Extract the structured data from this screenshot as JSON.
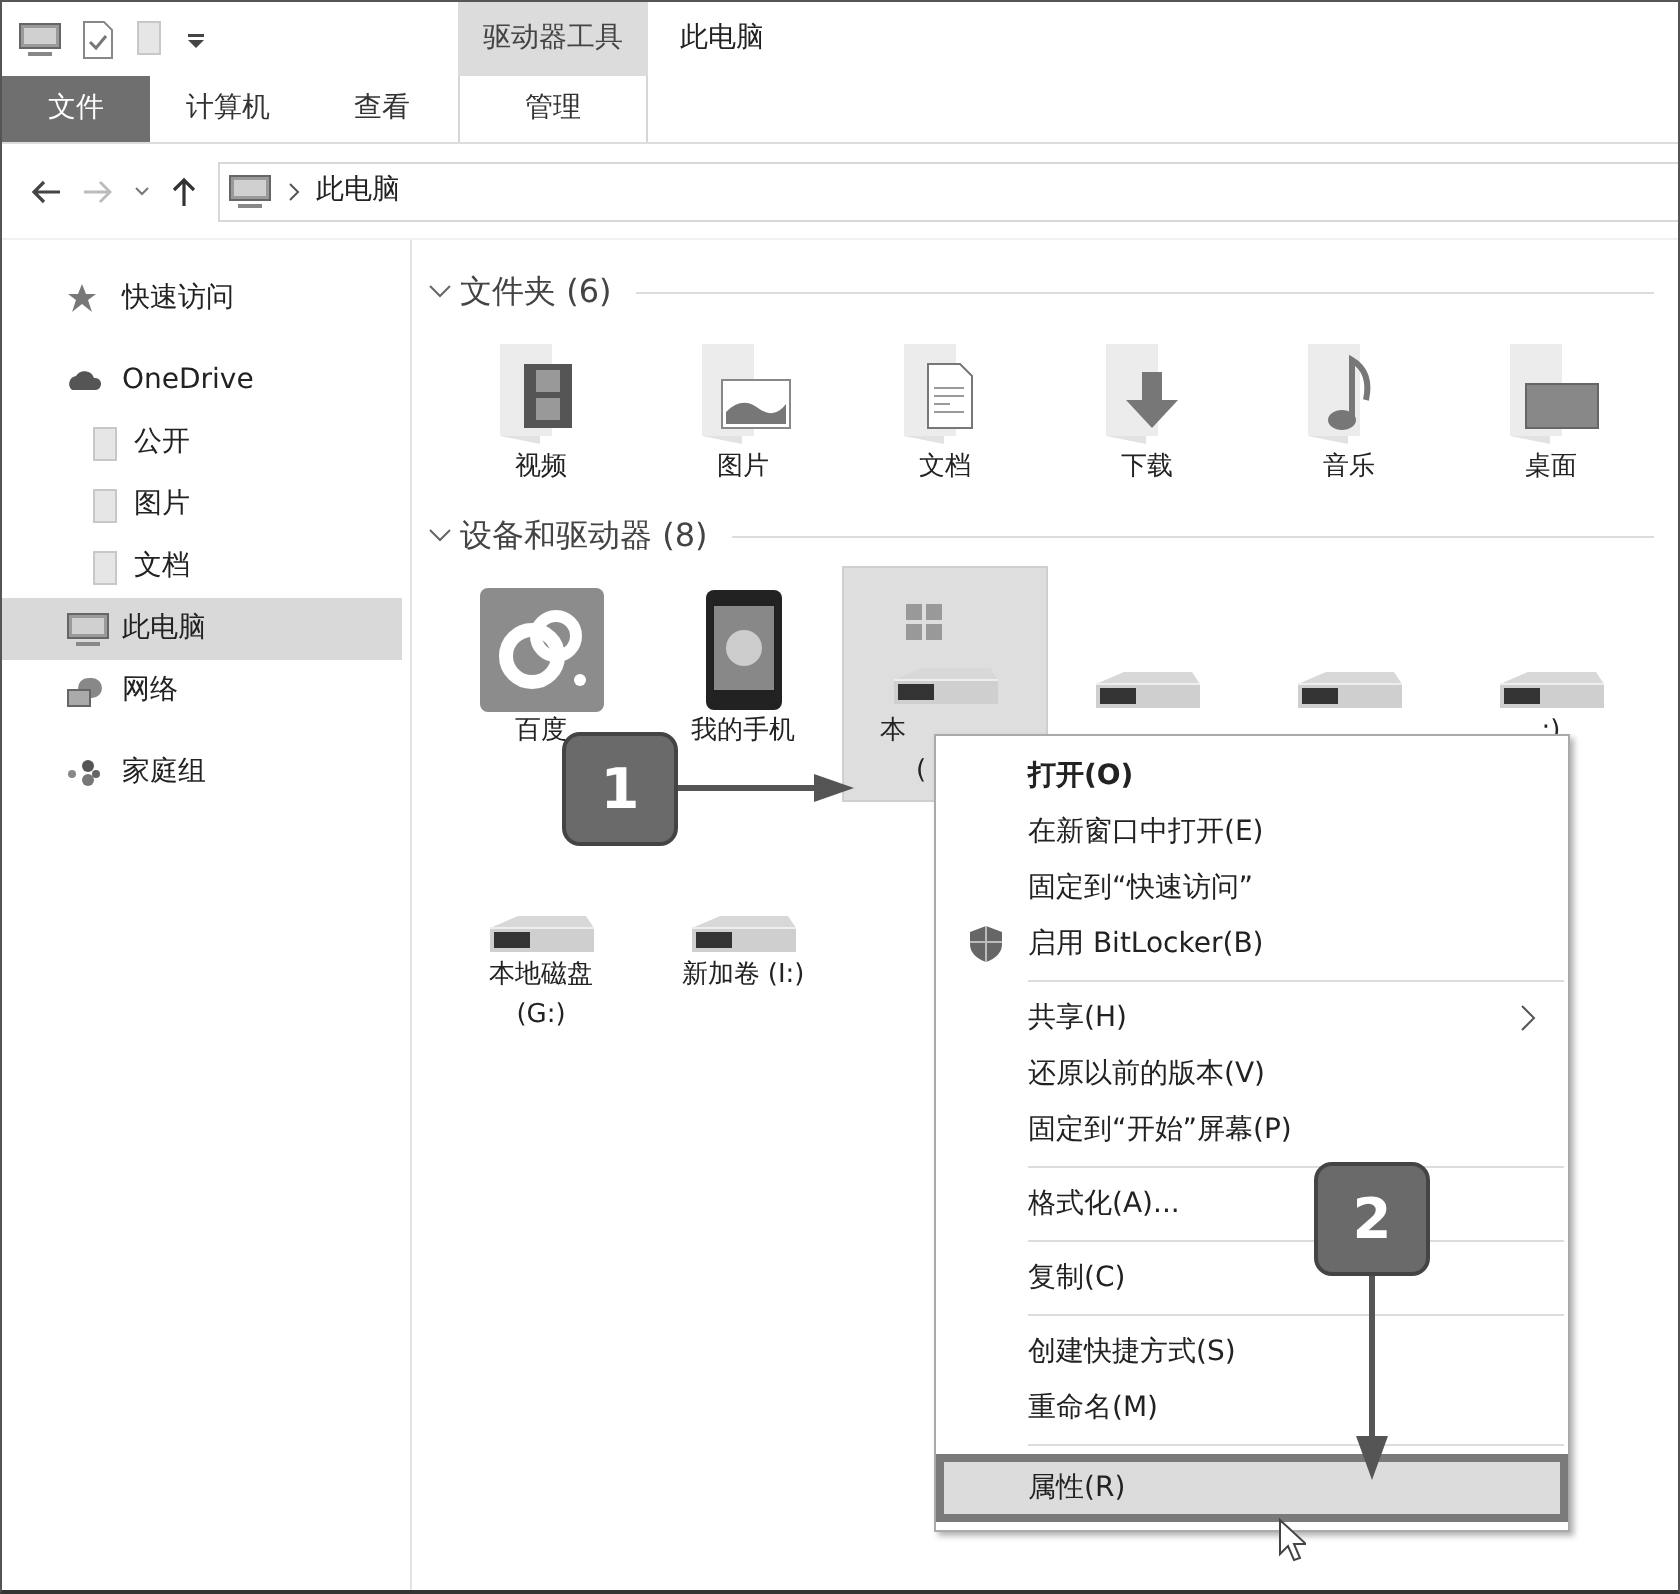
{
  "window": {
    "title": "此电脑",
    "context_tab_group": "驱动器工具"
  },
  "ribbon_tabs": [
    {
      "label": "文件",
      "kind": "file"
    },
    {
      "label": "计算机",
      "kind": "tab"
    },
    {
      "label": "查看",
      "kind": "tab"
    },
    {
      "label": "管理",
      "kind": "context"
    }
  ],
  "address_bar": {
    "path": [
      "此电脑"
    ]
  },
  "sidebar": {
    "items": [
      {
        "label": "快速访问",
        "kind": "star",
        "selected": false
      },
      {
        "label": "OneDrive",
        "kind": "cloud",
        "selected": false,
        "children": [
          {
            "label": "公开",
            "kind": "folder",
            "selected": false
          },
          {
            "label": "图片",
            "kind": "folder",
            "selected": false
          },
          {
            "label": "文档",
            "kind": "folder",
            "selected": false
          }
        ]
      },
      {
        "label": "此电脑",
        "kind": "pc",
        "selected": true
      },
      {
        "label": "网络",
        "kind": "network",
        "selected": false
      },
      {
        "label": "家庭组",
        "kind": "homegroup",
        "selected": false
      }
    ]
  },
  "groups": [
    {
      "header": "文件夹 (6)",
      "items": [
        {
          "label": "视频",
          "kind": "video"
        },
        {
          "label": "图片",
          "kind": "pictures"
        },
        {
          "label": "文档",
          "kind": "documents"
        },
        {
          "label": "下载",
          "kind": "downloads"
        },
        {
          "label": "音乐",
          "kind": "music"
        },
        {
          "label": "桌面",
          "kind": "desktop"
        }
      ]
    },
    {
      "header": "设备和驱动器 (8)",
      "items": [
        {
          "label": "百度",
          "kind": "cloud-app",
          "selected": false
        },
        {
          "label": "我的手机",
          "kind": "phone",
          "selected": false
        },
        {
          "label": "本",
          "label_line2": "(",
          "kind": "system-drive",
          "selected": true
        },
        {
          "kind": "drive",
          "selected": false
        },
        {
          "kind": "drive",
          "selected": false
        },
        {
          "label": ":)",
          "kind": "drive",
          "selected": false
        },
        {
          "label": "本地磁盘",
          "label_line2": "(G:)",
          "kind": "drive",
          "selected": false
        },
        {
          "label": "新加卷 (I:)",
          "kind": "drive",
          "selected": false
        }
      ]
    }
  ],
  "context_menu": {
    "groups": [
      [
        {
          "label": "打开(O)",
          "kind": "default",
          "selected": false
        },
        {
          "label": "在新窗口中打开(E)",
          "kind": "normal",
          "selected": false
        },
        {
          "label": "固定到“快速访问”",
          "kind": "normal",
          "selected": false
        },
        {
          "label": "启用 BitLocker(B)",
          "kind": "shield",
          "selected": false
        }
      ],
      [
        {
          "label": "共享(H)",
          "kind": "submenu",
          "selected": false
        },
        {
          "label": "还原以前的版本(V)",
          "kind": "normal",
          "selected": false
        },
        {
          "label": "固定到“开始”屏幕(P)",
          "kind": "normal",
          "selected": false
        }
      ],
      [
        {
          "label": "格式化(A)...",
          "kind": "normal",
          "selected": false
        }
      ],
      [
        {
          "label": "复制(C)",
          "kind": "normal",
          "selected": false
        }
      ],
      [
        {
          "label": "创建快捷方式(S)",
          "kind": "normal",
          "selected": false
        },
        {
          "label": "重命名(M)",
          "kind": "normal",
          "selected": false
        }
      ],
      [
        {
          "label": "属性(R)",
          "kind": "normal",
          "selected": true
        }
      ]
    ]
  },
  "callouts": [
    {
      "label": "1"
    },
    {
      "label": "2"
    }
  ]
}
